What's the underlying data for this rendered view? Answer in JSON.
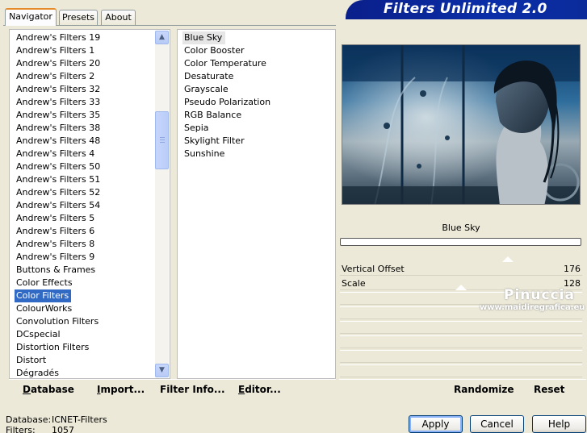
{
  "tabs": [
    "Navigator",
    "Presets",
    "About"
  ],
  "banner_title": "Filters Unlimited 2.0",
  "categories": [
    "Andrew's Filters 19",
    "Andrew's Filters 1",
    "Andrew's Filters 20",
    "Andrew's Filters 2",
    "Andrew's Filters 32",
    "Andrew's Filters 33",
    "Andrew's Filters 35",
    "Andrew's Filters 38",
    "Andrew's Filters 48",
    "Andrew's Filters 4",
    "Andrew's Filters 50",
    "Andrew's Filters 51",
    "Andrew's Filters 52",
    "Andrew's Filters 54",
    "Andrew's Filters 5",
    "Andrew's Filters 6",
    "Andrew's Filters 8",
    "Andrew's Filters 9",
    "Buttons & Frames",
    "Color Effects",
    "Color Filters",
    "ColourWorks",
    "Convolution Filters",
    "DCspecial",
    "Distortion Filters",
    "Distort",
    "Dégradés"
  ],
  "selected_category": "Color Filters",
  "filters": [
    "Blue Sky",
    "Color Booster",
    "Color Temperature",
    "Desaturate",
    "Grayscale",
    "Pseudo Polarization",
    "RGB Balance",
    "Sepia",
    "Skylight Filter",
    "Sunshine"
  ],
  "selected_filter": "Blue Sky",
  "filter_name": "Blue Sky",
  "params": [
    {
      "label": "Vertical Offset",
      "value": "176"
    },
    {
      "label": "Scale",
      "value": "128"
    }
  ],
  "watermark": {
    "name": "Pinuccia",
    "site": "www.maidiregrafica.eu"
  },
  "left_buttons": [
    {
      "u": "D",
      "rest": "atabase"
    },
    {
      "u": "I",
      "rest": "mport..."
    },
    {
      "u": "Filter I",
      "rest": "nfo..."
    },
    {
      "u": "E",
      "rest": "ditor..."
    }
  ],
  "right_buttons": [
    "Randomize",
    "Reset"
  ],
  "dialog_buttons": [
    "Apply",
    "Cancel",
    "Help"
  ],
  "status": {
    "database_label": "Database:",
    "database_value": "ICNET-Filters",
    "filters_label": "Filters:",
    "filters_value": "1057"
  },
  "colors": {
    "selection": "#316ac5",
    "banner": "#0a2ea8",
    "face": "#ece9d8"
  }
}
